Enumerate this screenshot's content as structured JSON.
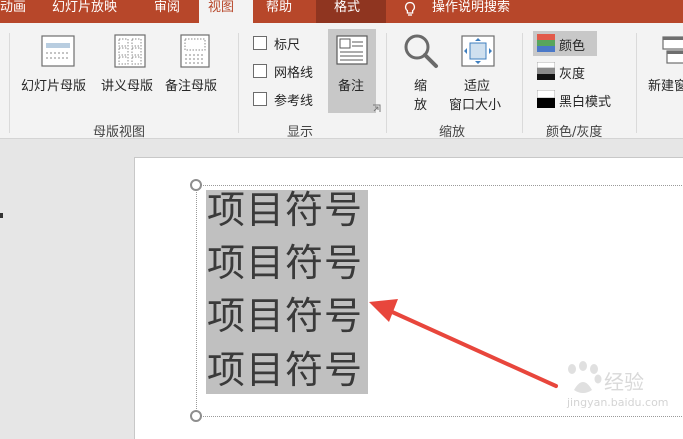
{
  "tabs": {
    "animation": "动画",
    "slideshow": "幻灯片放映",
    "review": "审阅",
    "view": "视图",
    "help": "帮助",
    "format": "格式",
    "tell_me": "操作说明搜索"
  },
  "ribbon": {
    "master_views": {
      "slide_master": "幻灯片母版",
      "handout_master": "讲义母版",
      "notes_master": "备注母版",
      "group_label": "母版视图"
    },
    "show": {
      "ruler": "标尺",
      "gridlines": "网格线",
      "guides": "参考线",
      "notes": "备注",
      "group_label": "显示"
    },
    "zoom": {
      "zoom_line1": "缩",
      "zoom_line2": "放",
      "fit_line1": "适应",
      "fit_line2": "窗口大小",
      "group_label": "缩放"
    },
    "color_gray": {
      "color": "颜色",
      "grayscale": "灰度",
      "bw": "黑白模式",
      "group_label": "颜色/灰度"
    },
    "window": {
      "new_window": "新建窗"
    }
  },
  "slide": {
    "bullets": [
      "项目符号",
      "项目符号",
      "项目符号",
      "项目符号"
    ]
  },
  "watermark": {
    "brand": "经验",
    "url": "jingyan.baidu.com"
  },
  "colors": {
    "accent": "#b7472a",
    "context_tab": "#8f3520",
    "arrow": "#e8463c"
  }
}
